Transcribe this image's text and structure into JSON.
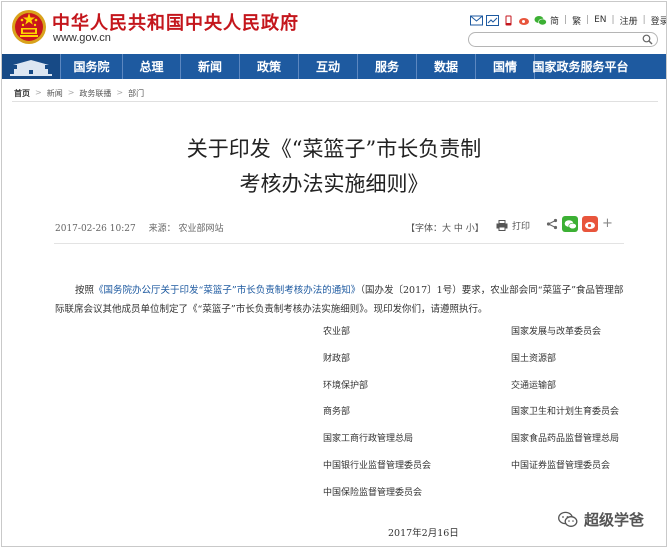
{
  "header": {
    "site_title": "中华人民共和国中央人民政府",
    "site_url": "www.gov.cn",
    "links": {
      "simplified": "简",
      "traditional": "繁",
      "english": "EN",
      "register": "注册",
      "login": "登录"
    },
    "search_placeholder": ""
  },
  "nav": {
    "items": [
      "国务院",
      "总理",
      "新闻",
      "政策",
      "互动",
      "服务",
      "数据",
      "国情",
      "国家政务服务平台"
    ]
  },
  "breadcrumb": [
    "首页",
    "新闻",
    "政务联播",
    "部门"
  ],
  "article": {
    "title_line1": "关于印发《“菜篮子”市长负责制",
    "title_line2": "考核办法实施细则》",
    "date": "2017-02-26 10:27",
    "source_label": "来源：",
    "source": "农业部网站",
    "font_size_label": "【字体：大 中 小】",
    "print_label": "打印",
    "para_prefix": "按照",
    "para_link": "《国务院办公厅关于印发“菜篮子”市长负责制考核办法的通知》",
    "para_rest": "（国办发〔2017〕1号）要求，农业部会同“菜篮子”食品管理部际联席会议其他成员单位制定了《“菜篮子”市长负责制考核办法实施细则》。现印发你们，请遵照执行。",
    "recipients_left": [
      "农业部",
      "财政部",
      "环境保护部",
      "商务部",
      "国家工商行政管理总局",
      "中国银行业监督管理委员会",
      "中国保险监督管理委员会"
    ],
    "recipients_right": [
      "国家发展与改革委员会",
      "国土资源部",
      "交通运输部",
      "国家卫生和计划生育委员会",
      "国家食品药品监督管理总局",
      "中国证券监督管理委员会"
    ],
    "sign_date": "2017年2月16日"
  },
  "watermark": "超级学爸",
  "colors": {
    "brand_red": "#c4161c",
    "nav_blue": "#1e5aa0",
    "link_blue": "#1e5aa0",
    "wechat_green": "#3cb034",
    "weibo_orange": "#e8553c"
  }
}
